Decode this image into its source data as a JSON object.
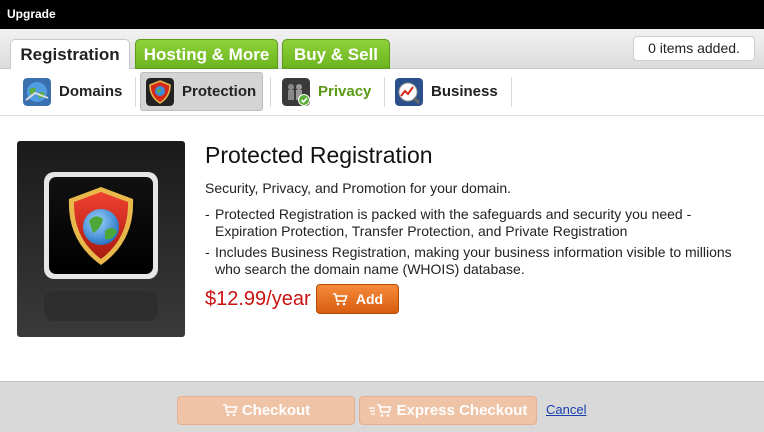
{
  "window": {
    "title": "Upgrade"
  },
  "tabs": [
    {
      "label": "Registration",
      "active": true
    },
    {
      "label": "Hosting & More",
      "active": false
    },
    {
      "label": "Buy & Sell",
      "active": false
    }
  ],
  "cart": {
    "status": "0 items added."
  },
  "subnav": [
    {
      "label": "Domains",
      "icon": "globe-icon",
      "selected": false
    },
    {
      "label": "Protection",
      "icon": "shield-icon",
      "selected": true
    },
    {
      "label": "Privacy",
      "icon": "privacy-icon",
      "selected": false
    },
    {
      "label": "Business",
      "icon": "chart-icon",
      "selected": false
    }
  ],
  "product": {
    "title": "Protected Registration",
    "subtitle": "Security, Privacy, and Promotion for your domain.",
    "bullets": [
      "Protected Registration is packed with the safeguards and security you need - Expiration Protection, Transfer Protection, and Private Registration",
      "Includes Business Registration, making your business information visible to millions who search the domain name (WHOIS) database."
    ],
    "price": "$12.99/year",
    "add_label": "Add"
  },
  "footer": {
    "checkout_label": "Checkout",
    "express_label": "Express Checkout",
    "cancel_label": "Cancel"
  },
  "colors": {
    "tab_green": "#7cc42a",
    "price_red": "#cc1111",
    "add_orange": "#e8701f",
    "checkout_disabled": "#efc3a6",
    "link_blue": "#1a3fae"
  }
}
